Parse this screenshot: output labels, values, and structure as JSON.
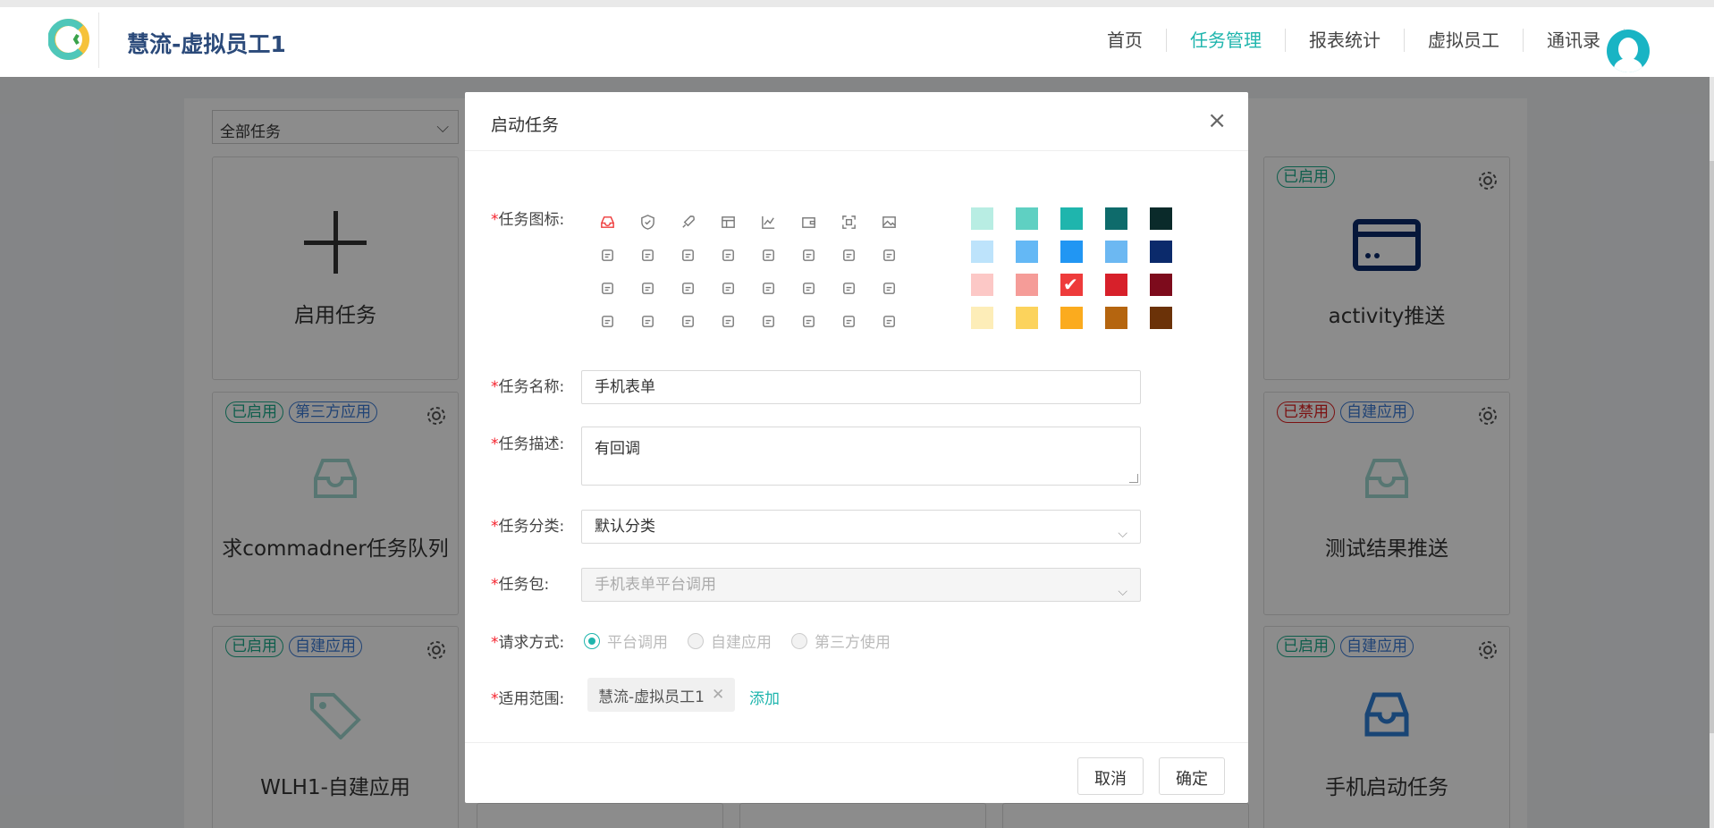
{
  "header": {
    "app_title": "慧流-虚拟员工1",
    "nav": [
      "首页",
      "任务管理",
      "报表统计",
      "虚拟员工",
      "通讯录"
    ],
    "nav_active": "任务管理"
  },
  "filter": {
    "selected": "全部任务"
  },
  "cards": {
    "create": {
      "title": "启用任务"
    },
    "c1": {
      "badges": [
        "已启用",
        "第三方应用"
      ],
      "title": "求commadner任务队列"
    },
    "c2": {
      "badges": [
        "已启用",
        "自建应用"
      ],
      "title": "WLH1-自建应用"
    },
    "c3": {
      "badges": [
        "已启用"
      ],
      "title": "activity推送"
    },
    "c4": {
      "badges": [
        "已禁用",
        "自建应用"
      ],
      "title": "测试结果推送"
    },
    "c5": {
      "badges": [
        "已启用",
        "自建应用"
      ],
      "title": "手机启动任务"
    }
  },
  "modal": {
    "title": "启动任务",
    "close_glyph": "×",
    "labels": {
      "icon": "任务图标:",
      "name": "任务名称:",
      "desc": "任务描述:",
      "category": "任务分类:",
      "package": "任务包:",
      "method": "请求方式:",
      "scope": "适用范围:"
    },
    "required_mark": "*",
    "name_value": "手机表单",
    "desc_value": "有回调",
    "category_value": "默认分类",
    "package_value": "手机表单平台调用",
    "methods": [
      "平台调用",
      "自建应用",
      "第三方使用"
    ],
    "method_selected": "平台调用",
    "scope_tag": "慧流-虚拟员工1",
    "add_label": "添加",
    "cancel_label": "取消",
    "ok_label": "确定",
    "icons": [
      "inbox-icon",
      "shield-icon",
      "rocket-icon",
      "table-icon",
      "line-chart-icon",
      "wallet-icon",
      "scan-icon",
      "image-icon",
      "mail-icon",
      "tray-icon",
      "upload-house-icon",
      "document-search-icon",
      "bar-chart-icon",
      "id-card-icon",
      "apps-icon",
      "video-icon",
      "calendar-icon",
      "file-download-icon",
      "credit-card-icon",
      "sound-icon",
      "fork-icon",
      "cluster-icon",
      "database-icon",
      "user-add-icon",
      "schedule-icon",
      "yuan-icon",
      "file-image-icon",
      "customer-service-icon",
      "paperclip-icon",
      "save-icon",
      "edit-square-icon",
      "tags-icon"
    ],
    "selected_icon": "inbox-icon",
    "colors": [
      "#b8ede3",
      "#5fd0c2",
      "#1fb5ad",
      "#0e6b6b",
      "#0a2a2a",
      "#bde3fb",
      "#64b8f5",
      "#2196f3",
      "#6cb8f2",
      "#0b2a6b",
      "#fcc8c6",
      "#f59c98",
      "#ee3b3b",
      "#d7202a",
      "#7d0b1c",
      "#fdedb8",
      "#fcd35c",
      "#fbab1e",
      "#b5650f",
      "#6b3208"
    ],
    "selected_color": "#ee3b3b"
  }
}
